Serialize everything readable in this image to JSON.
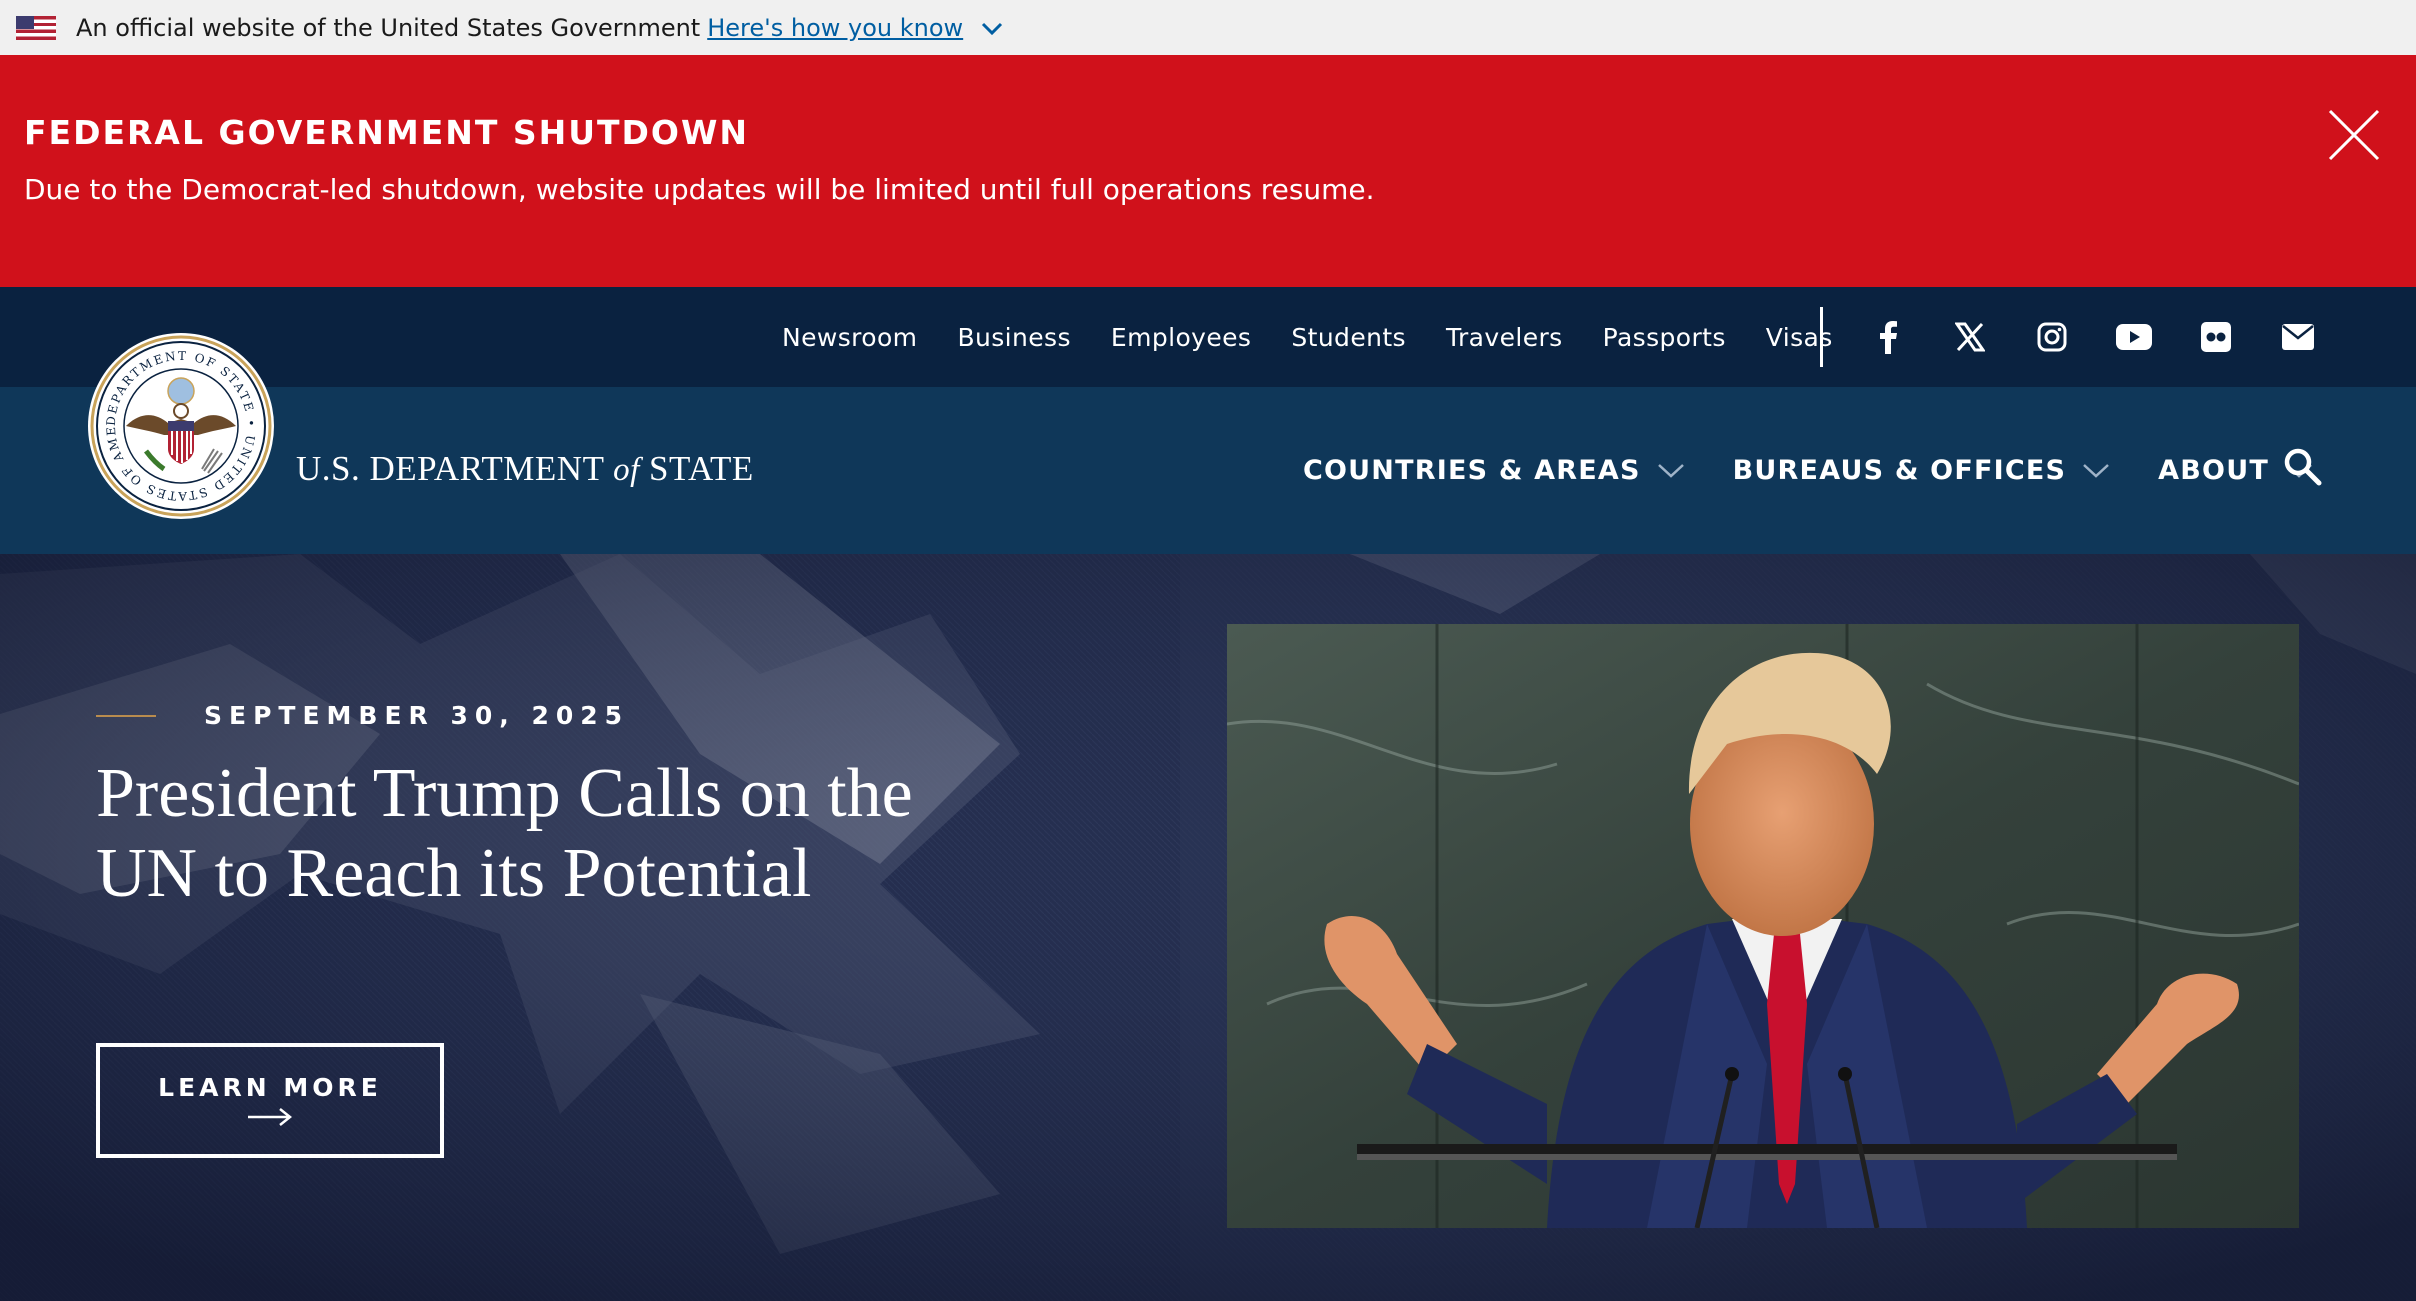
{
  "gov_banner": {
    "text": "An official website of the United States Government",
    "link": "Here's how you know"
  },
  "alert": {
    "title": "FEDERAL GOVERNMENT SHUTDOWN",
    "message": "Due to the Democrat-led shutdown, website updates will be limited until full operations resume."
  },
  "utility_nav": {
    "links": [
      "Newsroom",
      "Business",
      "Employees",
      "Students",
      "Travelers",
      "Passports",
      "Visas"
    ],
    "social_icons": [
      "facebook-icon",
      "x-icon",
      "instagram-icon",
      "youtube-icon",
      "flickr-icon",
      "email-icon"
    ]
  },
  "brand": {
    "name_prefix": "U.S. DEPARTMENT",
    "name_of": "of",
    "name_suffix": "STATE",
    "seal_text": "DEPARTMENT OF STATE • UNITED STATES OF AMERICA •"
  },
  "main_nav": {
    "items": [
      "COUNTRIES & AREAS",
      "BUREAUS & OFFICES",
      "ABOUT"
    ]
  },
  "hero": {
    "date": "SEPTEMBER 30, 2025",
    "headline": "President Trump Calls on the UN to Reach its Potential",
    "cta": "LEARN MORE"
  },
  "colors": {
    "alert_red": "#d0111b",
    "navy_dark": "#0a2240",
    "navy": "#0f3759",
    "gold": "#b98c4e",
    "link_blue": "#005ea2"
  }
}
